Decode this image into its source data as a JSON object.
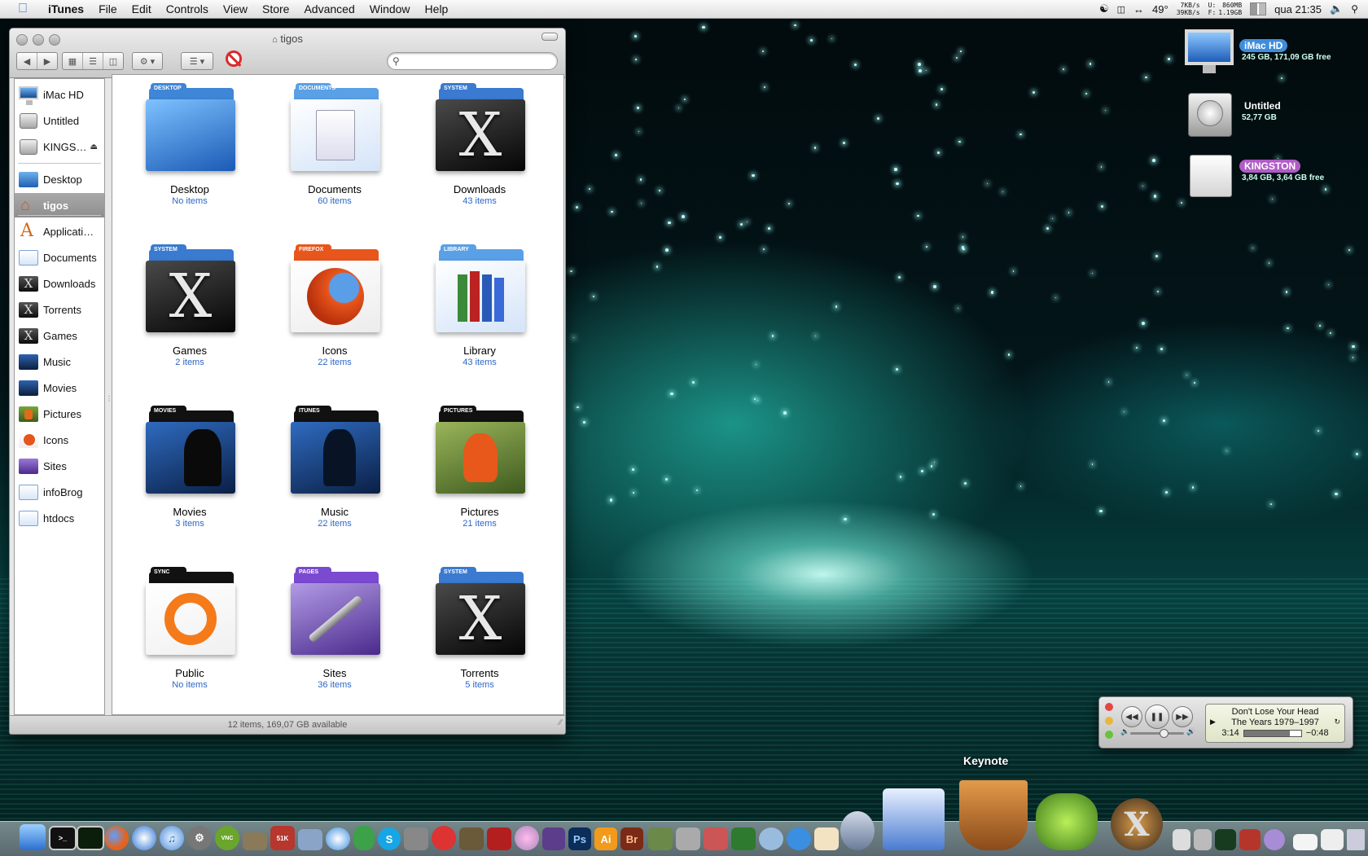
{
  "menubar": {
    "app_name": "iTunes",
    "menus": [
      "File",
      "Edit",
      "Controls",
      "View",
      "Store",
      "Advanced",
      "Window",
      "Help"
    ],
    "temperature": "49°",
    "net_up": "7KB/s",
    "net_down": "39KB/s",
    "mem_used_label": "U:",
    "mem_used": "860MB",
    "mem_free_label": "F:",
    "mem_free": "1.19GB",
    "clock": "qua 21:35"
  },
  "finder": {
    "title": "tigos",
    "search_placeholder": "",
    "sidebar": [
      {
        "label": "iMac HD",
        "icon": "imac-icon"
      },
      {
        "label": "Untitled",
        "icon": "hard-disk-icon"
      },
      {
        "label": "KINGS…",
        "icon": "usb-drive-icon",
        "eject": "⏏"
      },
      {
        "label": "Desktop",
        "icon": "desktop-folder-icon"
      },
      {
        "label": "tigos",
        "icon": "home-icon",
        "selected": true
      },
      {
        "label": "Applicati…",
        "icon": "applications-icon"
      },
      {
        "label": "Documents",
        "icon": "documents-folder-icon"
      },
      {
        "label": "Downloads",
        "icon": "downloads-folder-icon"
      },
      {
        "label": "Torrents",
        "icon": "torrents-folder-icon"
      },
      {
        "label": "Games",
        "icon": "games-folder-icon"
      },
      {
        "label": "Music",
        "icon": "music-folder-icon"
      },
      {
        "label": "Movies",
        "icon": "movies-folder-icon"
      },
      {
        "label": "Pictures",
        "icon": "pictures-folder-icon"
      },
      {
        "label": "Icons",
        "icon": "icons-folder-icon"
      },
      {
        "label": "Sites",
        "icon": "sites-folder-icon"
      },
      {
        "label": "infoBrog",
        "icon": "folder-icon"
      },
      {
        "label": "htdocs",
        "icon": "folder-icon"
      }
    ],
    "items": [
      {
        "name": "Desktop",
        "count": "No items",
        "tab": "DESKTOP",
        "style": "blue",
        "glyph": ""
      },
      {
        "name": "Documents",
        "count": "60 items",
        "tab": "DOCUMENTS",
        "style": "white",
        "glyph": "doc"
      },
      {
        "name": "Downloads",
        "count": "43 items",
        "tab": "SYSTEM",
        "style": "dark",
        "glyph": "X"
      },
      {
        "name": "Games",
        "count": "2 items",
        "tab": "SYSTEM",
        "style": "dark",
        "glyph": "X"
      },
      {
        "name": "Icons",
        "count": "22 items",
        "tab": "FIREFOX",
        "style": "orange",
        "glyph": "fox"
      },
      {
        "name": "Library",
        "count": "43 items",
        "tab": "LIBRARY",
        "style": "white",
        "glyph": "books"
      },
      {
        "name": "Movies",
        "count": "3 items",
        "tab": "MOVIES",
        "style": "darkblue",
        "glyph": "singer"
      },
      {
        "name": "Music",
        "count": "22 items",
        "tab": "ITUNES",
        "style": "darkblue",
        "glyph": "ipod"
      },
      {
        "name": "Pictures",
        "count": "21 items",
        "tab": "PICTURES",
        "style": "photo",
        "glyph": "photo"
      },
      {
        "name": "Public",
        "count": "No items",
        "tab": "SYNC",
        "style": "orangewhite",
        "glyph": "sync"
      },
      {
        "name": "Sites",
        "count": "36 items",
        "tab": "PAGES",
        "style": "purple",
        "glyph": "pen"
      },
      {
        "name": "Torrents",
        "count": "5 items",
        "tab": "SYSTEM",
        "style": "dark",
        "glyph": "X"
      }
    ],
    "status": "12 items, 169,07 GB available"
  },
  "drives": [
    {
      "name": "iMac HD",
      "info": "245 GB, 171,09 GB free",
      "label_color": "#3e8ddd",
      "icon": "imac-icon"
    },
    {
      "name": "Untitled",
      "info": "52,77 GB",
      "label_color": "",
      "icon": "hard-disk-icon"
    },
    {
      "name": "KINGSTON",
      "info": "3,84 GB, 3,64 GB free",
      "label_color": "#b05cc6",
      "icon": "usb-drive-icon"
    }
  ],
  "miniplayer": {
    "song": "Don't Lose Your Head",
    "album": "The Years 1979–1997",
    "elapsed": "3:14",
    "remaining": "−0:48",
    "progress": 0.8,
    "volume": 0.6
  },
  "dock": {
    "hover_label": "Keynote"
  }
}
